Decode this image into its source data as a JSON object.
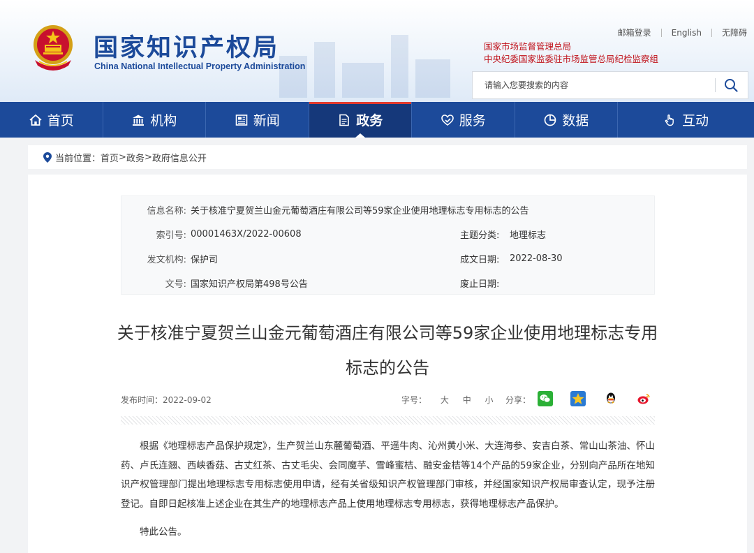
{
  "header": {
    "site_title": "国家知识产权局",
    "site_subtitle": "China National Intellectual Property Administration",
    "top_links": [
      "邮箱登录",
      "English",
      "无障碍"
    ],
    "supervisor_1": "国家市场监督管理总局",
    "supervisor_2": "中央纪委国家监委驻市场监管总局纪检监察组",
    "search_placeholder": "请输入您要搜索的内容",
    "brand_color": "#1c4a9a",
    "accent_color": "#c0121b"
  },
  "nav": {
    "items": [
      {
        "label": "首页",
        "icon": "home-icon"
      },
      {
        "label": "机构",
        "icon": "institution-icon"
      },
      {
        "label": "新闻",
        "icon": "news-icon"
      },
      {
        "label": "政务",
        "icon": "government-affairs-icon",
        "active": true
      },
      {
        "label": "服务",
        "icon": "service-icon"
      },
      {
        "label": "数据",
        "icon": "data-pie-icon"
      },
      {
        "label": "互动",
        "icon": "interaction-hand-icon"
      }
    ]
  },
  "breadcrumb": {
    "prefix": "当前位置：",
    "items": [
      "首页",
      "政务",
      "政府信息公开"
    ],
    "separator": ">"
  },
  "meta": {
    "info_name_label": "信息名称:",
    "info_name": "关于核准宁夏贺兰山金元葡萄酒庄有限公司等59家企业使用地理标志专用标志的公告",
    "index_label": "索引号:",
    "index": "00001463X/2022-00608",
    "topic_label": "主题分类:",
    "topic": "地理标志",
    "issuer_label": "发文机构:",
    "issuer": "保护司",
    "date_label": "成文日期:",
    "date": "2022-08-30",
    "docno_label": "文号:",
    "docno": "国家知识产权局第498号公告",
    "abolish_label": "废止日期:",
    "abolish": ""
  },
  "article": {
    "title": "关于核准宁夏贺兰山金元葡萄酒庄有限公司等59家企业使用地理标志专用标志的公告",
    "publish_label": "发布时间：",
    "publish_date": "2022-09-02",
    "font_size_label": "字号：",
    "font_sizes": [
      "大",
      "中",
      "小"
    ],
    "share_label": "分享：",
    "share_icons": [
      "wechat-icon",
      "qzone-icon",
      "qq-icon",
      "weibo-icon"
    ],
    "body": "根据《地理标志产品保护规定》，生产贺兰山东麓葡萄酒、平遥牛肉、沁州黄小米、大连海参、安吉白茶、常山山茶油、怀山药、卢氏连翘、西峡香菇、古丈红茶、古丈毛尖、会同魔芋、雪峰蜜桔、融安金桔等14个产品的59家企业，分别向产品所在地知识产权管理部门提出地理标志专用标志使用申请，经有关省级知识产权管理部门审核，并经国家知识产权局审查认定，现予注册登记。自即日起核准上述企业在其生产的地理标志产品上使用地理标志专用标志，获得地理标志产品保护。",
    "closing": "特此公告。"
  }
}
